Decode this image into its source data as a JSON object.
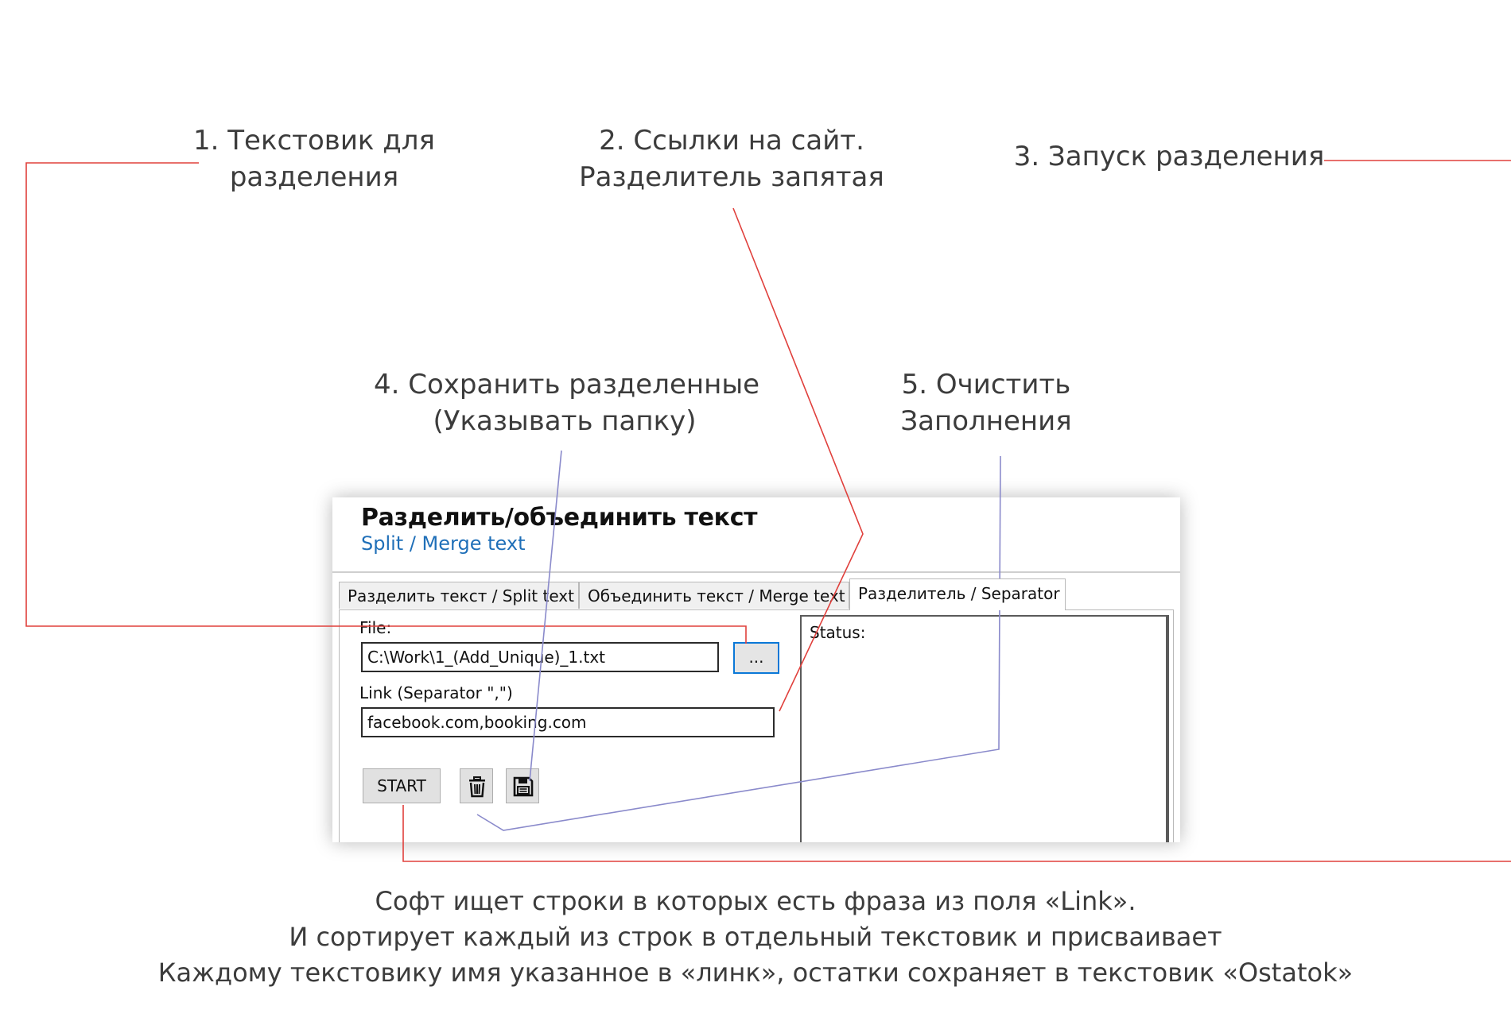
{
  "callouts": {
    "c1": [
      "1. Текстовик для",
      "разделения"
    ],
    "c2": [
      "2. Ссылки на сайт.",
      "Разделитель запятая"
    ],
    "c3": [
      "3. Запуск разделения"
    ],
    "c4": [
      "4. Сохранить разделенные",
      "(Указывать папку)"
    ],
    "c5": [
      "5. Очистить",
      "Заполнения"
    ]
  },
  "colors": {
    "red_connector": "#e0403c",
    "blue_connector": "#8a8acb",
    "subtitle_blue": "#1f6fb8"
  },
  "window": {
    "title": "Разделить/объединить текст",
    "subtitle": "Split / Merge text",
    "tabs": [
      {
        "label": "Разделить текст / Split text",
        "active": false
      },
      {
        "label": "Объединить текст / Merge text",
        "active": false
      },
      {
        "label": "Разделитель / Separator",
        "active": true
      }
    ],
    "file_label": "File:",
    "file_value": "C:\\Work\\1_(Add_Unique)_1.txt",
    "browse_label": "...",
    "link_label": "Link (Separator \",\")",
    "link_value": "facebook.com,booking.com",
    "start_label": "START",
    "clear_icon": "trash-icon",
    "save_icon": "floppy-disk-icon",
    "status_label": "Status:"
  },
  "caption": [
    "Софт ищет строки в которых есть фраза из поля «Link».",
    "И сортирует каждый из строк в отдельный текстовик и присваивает",
    "Каждому текстовику имя указанное в «линк», остатки сохраняет в текстовик «Ostatok»"
  ]
}
